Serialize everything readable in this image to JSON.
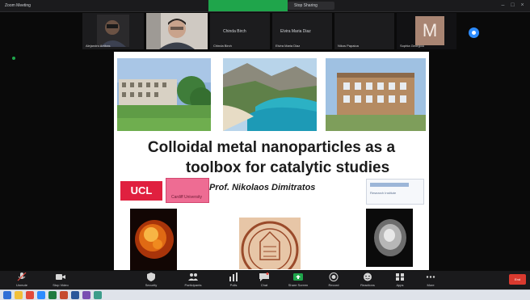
{
  "window": {
    "title": "Zoom Meeting",
    "share_pill_label": "Stop Sharing",
    "controls": [
      "minimize",
      "maximize",
      "close"
    ]
  },
  "gallery": {
    "tiles": [
      {
        "name": "Alejandro Arribas",
        "kind": "video"
      },
      {
        "name": "",
        "kind": "video"
      },
      {
        "name": "Chinda Birch",
        "kind": "name-only",
        "display": "Chinda Birch"
      },
      {
        "name": "Elvira Maria Diaz",
        "kind": "name-only",
        "display": "Elvira Maria Diaz"
      },
      {
        "name": "Nikos Papaioa",
        "kind": "name-only"
      },
      {
        "name": "Sophia Georgiou",
        "kind": "name-only"
      }
    ],
    "avatar_initial": "M"
  },
  "slide": {
    "title_line1": "Colloidal metal nanoparticles as a",
    "title_line2": "toolbox for catalytic studies",
    "author": "Prof. Nikolaos Dimitratos",
    "logo_left": "UCL",
    "logo_pink_caption": "Cardiff University",
    "logo_right_caption": "Research Institute"
  },
  "toolbar": {
    "items": [
      {
        "label": "Unmute",
        "icon": "mic-muted-icon"
      },
      {
        "label": "Stop Video",
        "icon": "video-camera-icon"
      },
      {
        "label": "Security",
        "icon": "shield-icon"
      },
      {
        "label": "Participants",
        "icon": "participants-icon"
      },
      {
        "label": "Polls",
        "icon": "poll-icon"
      },
      {
        "label": "Chat",
        "icon": "chat-icon"
      },
      {
        "label": "Share Screen",
        "icon": "share-screen-icon"
      },
      {
        "label": "Record",
        "icon": "record-icon"
      },
      {
        "label": "Reactions",
        "icon": "reactions-icon"
      },
      {
        "label": "Apps",
        "icon": "apps-icon"
      },
      {
        "label": "More",
        "icon": "more-icon"
      }
    ],
    "end_label": "End"
  },
  "colors": {
    "accent_green": "#1fa54b",
    "zoom_blue": "#2d8cff",
    "end_red": "#d93a2f",
    "ucl_red": "#e0203f"
  }
}
